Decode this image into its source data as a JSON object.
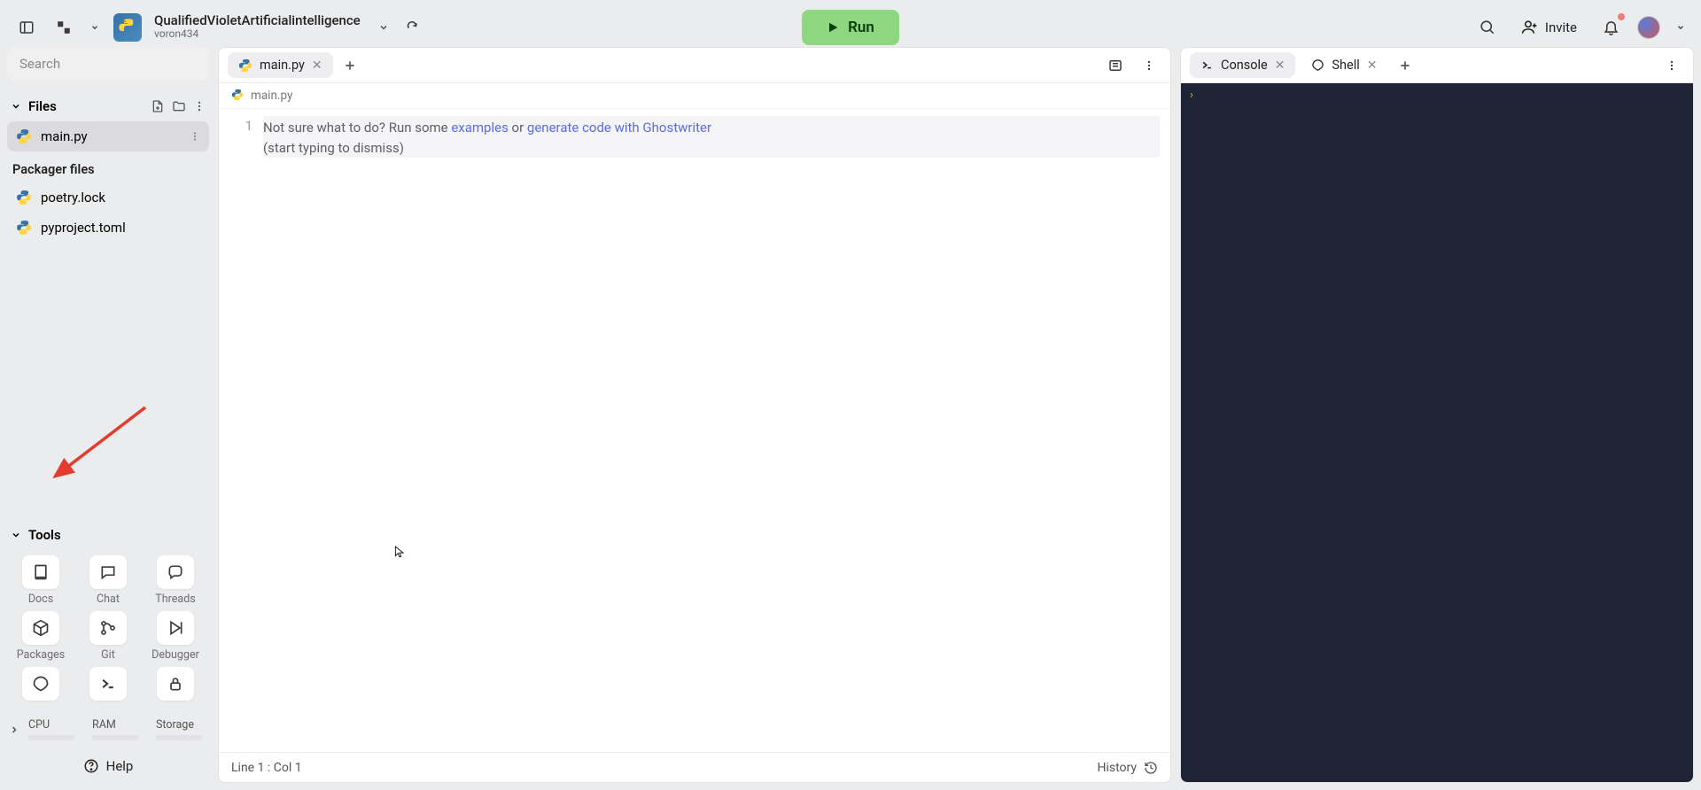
{
  "header": {
    "title": "QualifiedVioletArtificialintelligence",
    "subtitle": "voron434",
    "run_label": "Run",
    "invite_label": "Invite"
  },
  "sidebar": {
    "search_placeholder": "Search",
    "files_label": "Files",
    "files": [
      {
        "name": "main.py",
        "active": true
      }
    ],
    "packager_label": "Packager files",
    "packager_files": [
      {
        "name": "poetry.lock"
      },
      {
        "name": "pyproject.toml"
      }
    ],
    "tools_label": "Tools",
    "tools": [
      {
        "label": "Docs",
        "icon": "docs"
      },
      {
        "label": "Chat",
        "icon": "chat"
      },
      {
        "label": "Threads",
        "icon": "threads"
      },
      {
        "label": "Packages",
        "icon": "packages"
      },
      {
        "label": "Git",
        "icon": "git"
      },
      {
        "label": "Debugger",
        "icon": "debugger"
      },
      {
        "label": "",
        "icon": "shell-icon"
      },
      {
        "label": "",
        "icon": "terminal"
      },
      {
        "label": "",
        "icon": "lock"
      }
    ],
    "meters": {
      "cpu": "CPU",
      "ram": "RAM",
      "storage": "Storage"
    },
    "help_label": "Help"
  },
  "editor": {
    "tab_label": "main.py",
    "breadcrumb": "main.py",
    "line_number": "1",
    "code_prefix": "Not sure what to do? Run some ",
    "code_link1": "examples",
    "code_mid": " or ",
    "code_link2": "generate code with Ghostwriter",
    "code_suffix": " (start typing to dismiss)",
    "status_left": "Line 1 : Col 1",
    "status_right": "History"
  },
  "right": {
    "console_label": "Console",
    "shell_label": "Shell",
    "prompt": "›"
  }
}
